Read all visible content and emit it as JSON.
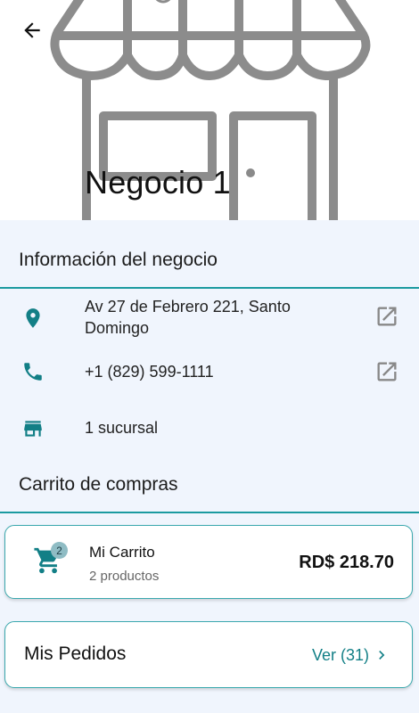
{
  "header": {
    "title": "Negocio 1",
    "icons": {
      "back": "arrow-left-icon",
      "hero": "storefront-icon"
    }
  },
  "info_section": {
    "heading": "Información del negocio",
    "address_line1": "Av 27 de Febrero 221, Santo",
    "address_line2": "Domingo",
    "phone": "+1 (829) 599-1111",
    "branches": "1 sucursal",
    "icons": {
      "address": "location-pin-icon",
      "phone": "phone-icon",
      "branch": "store-icon",
      "external": "open-external-icon"
    }
  },
  "cart_section": {
    "heading": "Carrito de compras",
    "title": "Mi Carrito",
    "subtitle": "2 productos",
    "badge": "2",
    "total": "RD$ 218.70",
    "icon": "shopping-cart-icon"
  },
  "orders": {
    "title": "Mis Pedidos",
    "link": "Ver (31)",
    "icon": "chevron-right-icon"
  },
  "colors": {
    "accent": "#127f86",
    "divider": "#1b9aa0",
    "background": "#f0f5fd",
    "card_border": "#3aa8ae"
  }
}
